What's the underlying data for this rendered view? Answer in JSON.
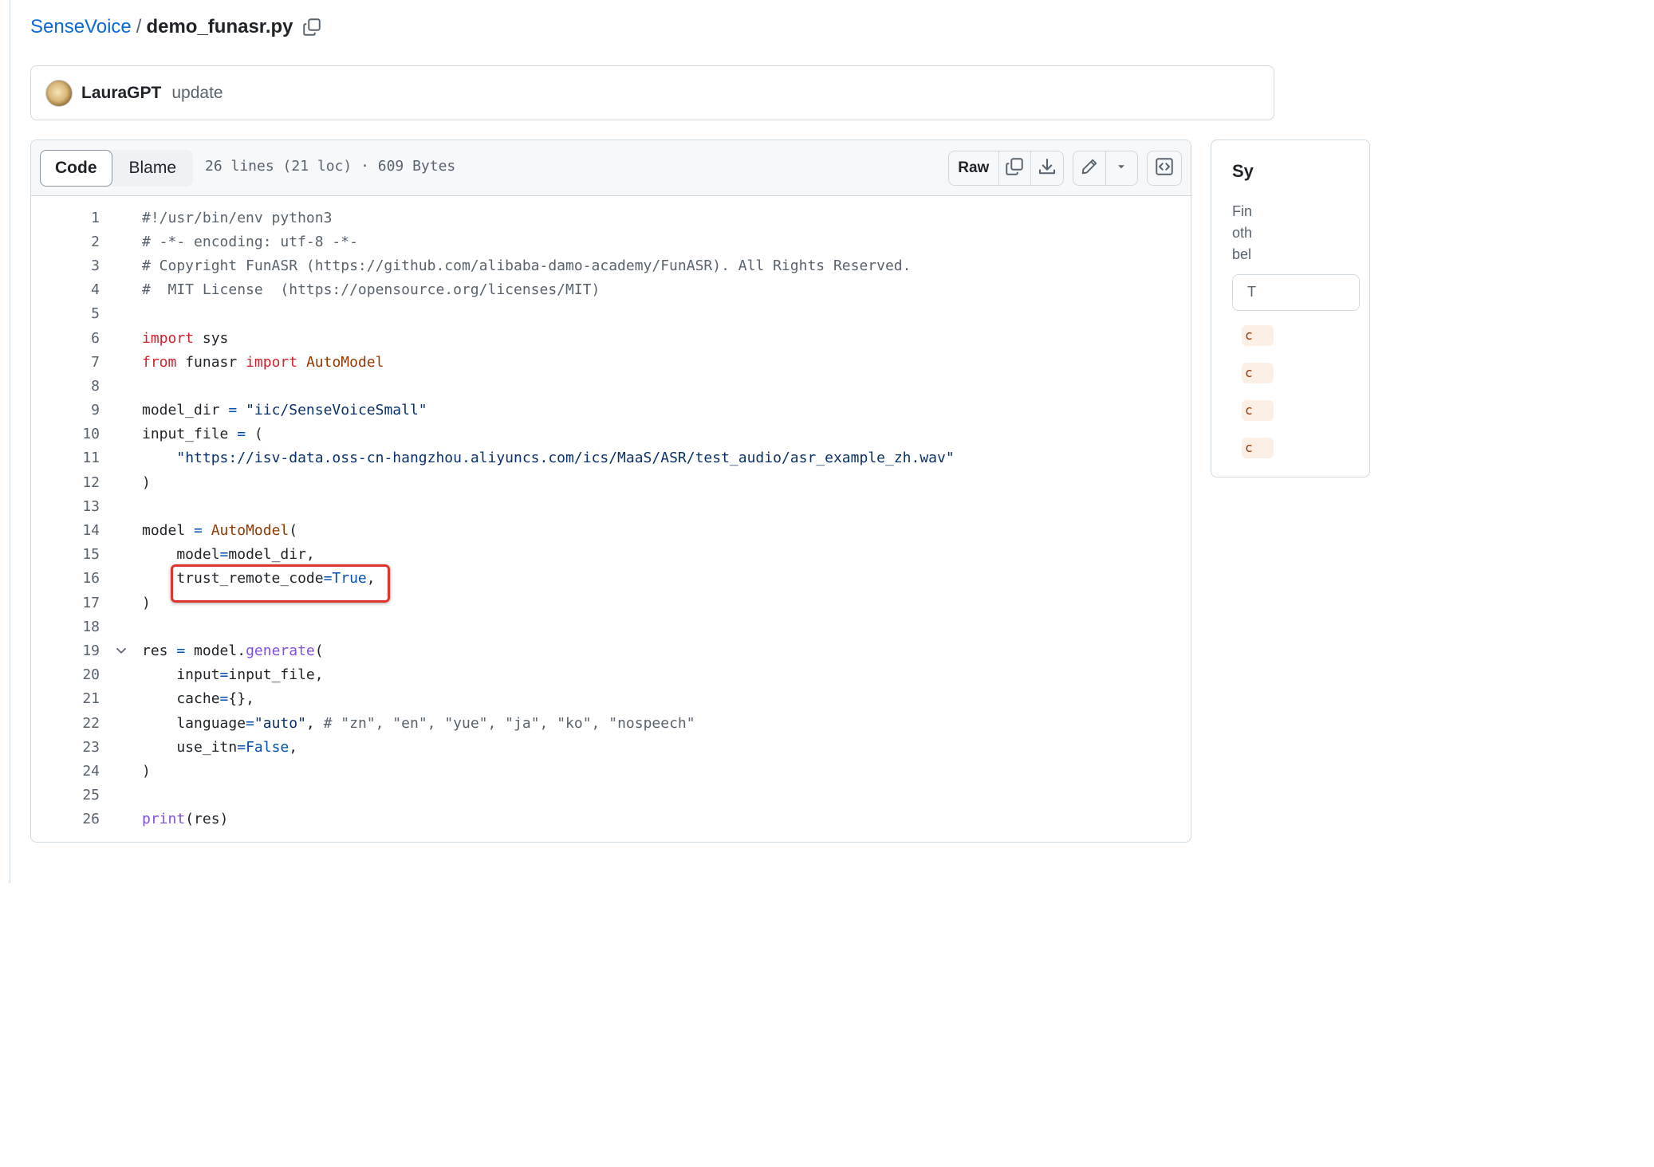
{
  "breadcrumb": {
    "repo": "SenseVoice",
    "separator": "/",
    "file": "demo_funasr.py",
    "copy_icon": "copy-icon"
  },
  "commit": {
    "author": "LauraGPT",
    "message": "update"
  },
  "toolbar": {
    "tabs": [
      "Code",
      "Blame"
    ],
    "active_tab": "Code",
    "file_info": "26 lines (21 loc) · 609 Bytes",
    "raw_label": "Raw",
    "icons": [
      "copy-icon",
      "download-icon",
      "pencil-icon",
      "triangle-down-icon",
      "code-square-icon"
    ]
  },
  "code": {
    "lines": [
      "#!/usr/bin/env python3",
      "# -*- encoding: utf-8 -*-",
      "# Copyright FunASR (https://github.com/alibaba-damo-academy/FunASR). All Rights Reserved.",
      "#  MIT License  (https://opensource.org/licenses/MIT)",
      "",
      "import sys",
      "from funasr import AutoModel",
      "",
      "model_dir = \"iic/SenseVoiceSmall\"",
      "input_file = (",
      "    \"https://isv-data.oss-cn-hangzhou.aliyuncs.com/ics/MaaS/ASR/test_audio/asr_example_zh.wav\"",
      ")",
      "",
      "model = AutoModel(",
      "    model=model_dir,",
      "    trust_remote_code=True,",
      ")",
      "",
      "res = model.generate(",
      "    input=input_file,",
      "    cache={},",
      "    language=\"auto\", # \"zn\", \"en\", \"yue\", \"ja\", \"ko\", \"nospeech\"",
      "    use_itn=False,",
      ")",
      "",
      "print(res)"
    ],
    "fold_line": 19,
    "highlighted_line": 16,
    "highlight_color": "#e0342f"
  },
  "side_panel": {
    "title": "Sy",
    "desc_lines": [
      "Fin",
      "oth",
      "bel"
    ],
    "input_text": "T",
    "tags": [
      "c",
      "c",
      "c",
      "c"
    ]
  },
  "colors": {
    "link": "#0969da",
    "keyword": "#cf222e",
    "string": "#0a3069",
    "constant": "#0550ae",
    "class": "#953800",
    "function": "#8250df",
    "comment": "#59636e"
  }
}
